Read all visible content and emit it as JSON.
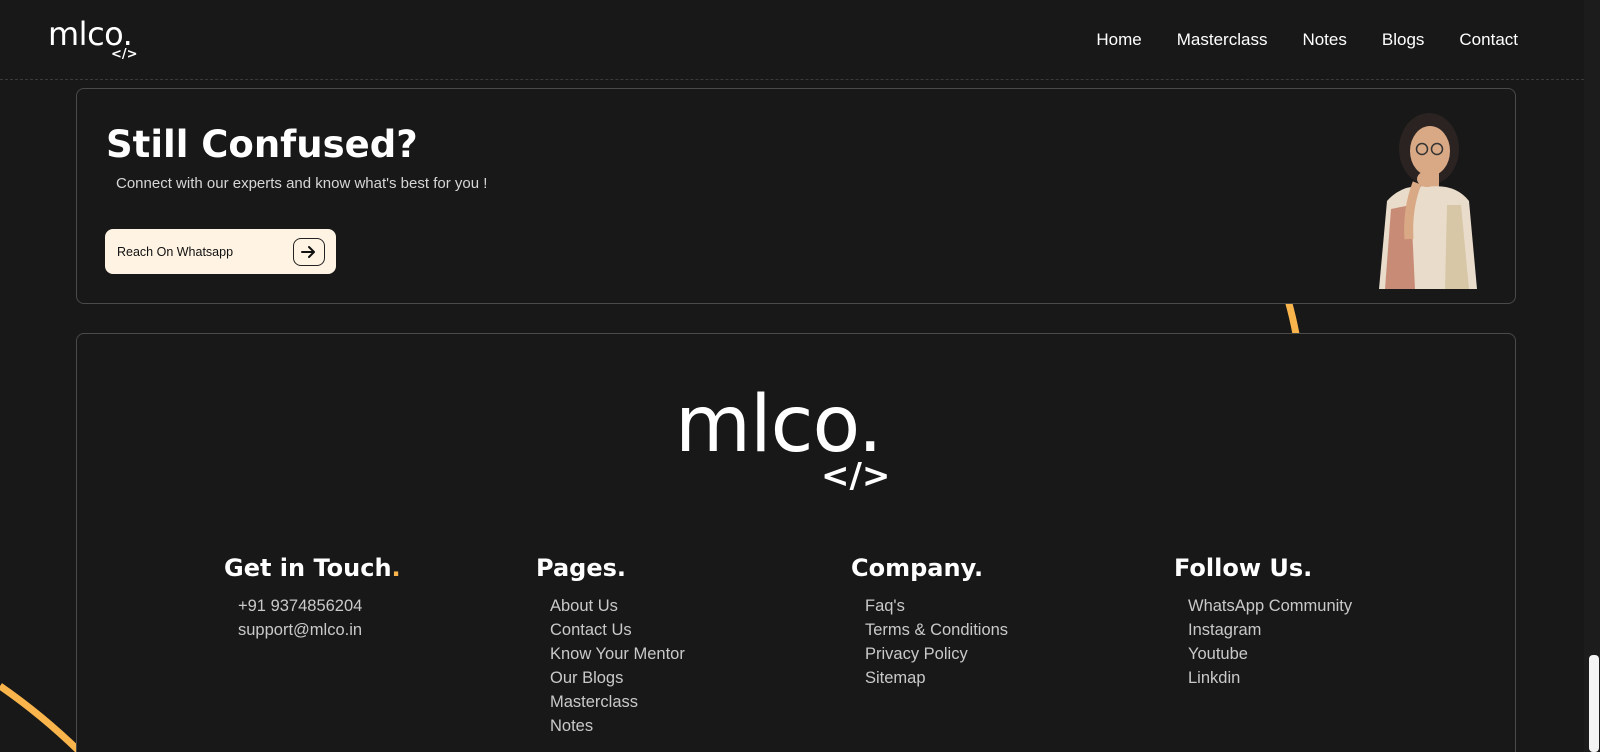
{
  "header": {
    "logo_text": "mlco.",
    "logo_code": "</>",
    "nav": [
      "Home",
      "Masterclass",
      "Notes",
      "Blogs",
      "Contact"
    ]
  },
  "cta": {
    "title": "Still Confused?",
    "subtitle": "Connect with our experts and know what's best for you !",
    "button_label": "Reach On Whatsapp",
    "button_icon": "arrow-right-icon"
  },
  "footer": {
    "logo_text": "mlco.",
    "logo_code": "</>",
    "columns": [
      {
        "title": "Get in Touch",
        "dot": ".",
        "items": [
          "+91 9374856204",
          "support@mlco.in"
        ]
      },
      {
        "title": "Pages.",
        "items": [
          "About Us",
          "Contact Us",
          "Know Your Mentor",
          "Our Blogs",
          "Masterclass",
          "Notes"
        ]
      },
      {
        "title": "Company.",
        "items": [
          "Faq's",
          "Terms & Conditions",
          "Privacy Policy",
          "Sitemap"
        ]
      },
      {
        "title": "Follow Us.",
        "items": [
          "WhatsApp Community",
          "Instagram",
          "Youtube",
          "Linkdin"
        ]
      }
    ]
  },
  "colors": {
    "background": "#181818",
    "accent": "#f9b54c",
    "button_bg": "#fff3e3"
  }
}
